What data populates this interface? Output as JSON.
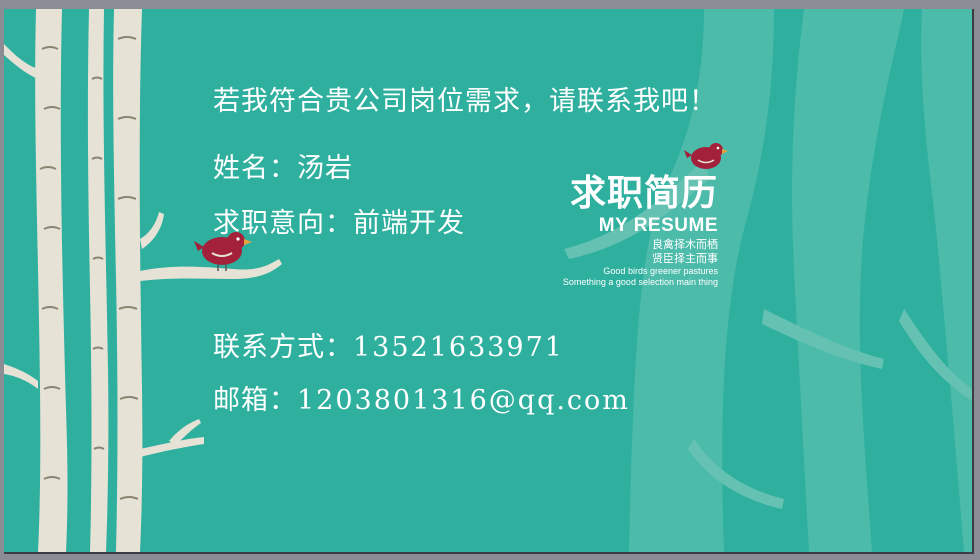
{
  "slide": {
    "headline": "若我符合贵公司岗位需求，请联系我吧！",
    "name_label": "姓名：",
    "name_value": "汤岩",
    "intent_label": "求职意向：",
    "intent_value": "前端开发",
    "phone_label": "联系方式：",
    "phone_value": "13521633971",
    "email_label": "邮箱：",
    "email_value": "1203801316@qq.com"
  },
  "logo": {
    "title_cn": "求职简历",
    "title_en": "MY RESUME",
    "slogan_1": "良禽择木而栖",
    "slogan_2": "贤臣择主而事",
    "slogan_en_1": "Good birds greener pastures",
    "slogan_en_2": "Something a good selection main thing"
  },
  "colors": {
    "background": "#2fb09f",
    "tree_light": "#e6e2d6",
    "tree_faded": "#7ccdbf",
    "bird_red": "#a3213a"
  }
}
